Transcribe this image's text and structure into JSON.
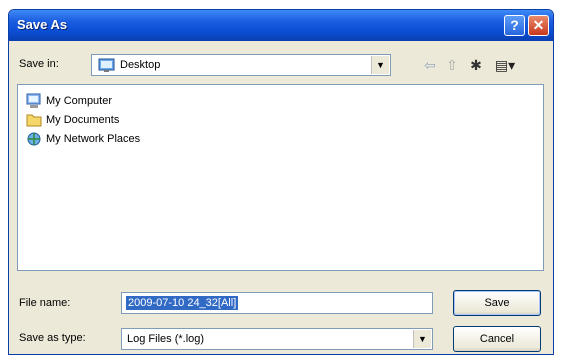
{
  "window": {
    "title": "Save As"
  },
  "title_buttons": {
    "help": "?",
    "close": "✕"
  },
  "toolbar": {
    "save_in_label": "Save in:",
    "save_in_value": "Desktop",
    "back": "⇦",
    "up": "⇧",
    "new_folder": "✱",
    "views": "▤▾"
  },
  "files": [
    {
      "label": "My Computer",
      "icon": "computer-icon"
    },
    {
      "label": "My Documents",
      "icon": "folder-icon"
    },
    {
      "label": "My Network Places",
      "icon": "network-icon"
    }
  ],
  "fields": {
    "file_name_label": "File name:",
    "file_name_value": "2009-07-10    24_32[All]",
    "save_type_label": "Save as type:",
    "save_type_value": "Log Files (*.log)"
  },
  "buttons": {
    "save": "Save",
    "cancel": "Cancel"
  }
}
